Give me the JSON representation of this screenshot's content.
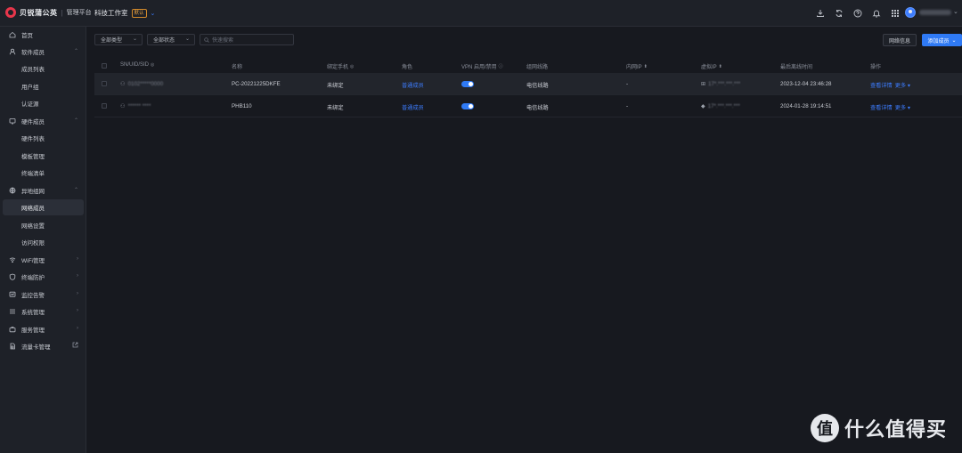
{
  "brand": {
    "name": "贝锐蒲公英",
    "sep": "|",
    "subtitle": "管理平台"
  },
  "workspace": {
    "name": "科技工作室",
    "badge": "默认"
  },
  "sidebar": {
    "items": [
      {
        "label": "首页"
      },
      {
        "label": "软件成员"
      },
      {
        "label": "成员列表"
      },
      {
        "label": "用户组"
      },
      {
        "label": "认证源"
      },
      {
        "label": "硬件成员"
      },
      {
        "label": "硬件列表"
      },
      {
        "label": "模板管理"
      },
      {
        "label": "终端清单"
      },
      {
        "label": "异地组网"
      },
      {
        "label": "网络成员"
      },
      {
        "label": "网络设置"
      },
      {
        "label": "访问权限"
      },
      {
        "label": "WiFi管理"
      },
      {
        "label": "终端防护"
      },
      {
        "label": "监控告警"
      },
      {
        "label": "系统管理"
      },
      {
        "label": "服务管理"
      },
      {
        "label": "流量卡管理"
      }
    ]
  },
  "toolbar": {
    "type_filter": "全部类型",
    "status_filter": "全部状态",
    "search_placeholder": "快速搜索",
    "info_button": "网络信息",
    "add_button": "添加成员"
  },
  "table": {
    "headers": [
      "SN/UID/SID",
      "名称",
      "绑定手机",
      "角色",
      "VPN 启用/禁用",
      "组网线路",
      "内网IP",
      "虚拟IP",
      "最后离线时间",
      "操作"
    ],
    "rows": [
      {
        "sn": "0102*****0000",
        "name": "PC-20221225DKFE",
        "phone": "未绑定",
        "role": "普通成员",
        "route": "电信线路",
        "lan_ip": "-",
        "virtual_ip": "17*.***.***.***",
        "last_offline": "2023-12-04 23:46:28",
        "action": "查看详情",
        "more": "更多"
      },
      {
        "sn": "****** ****",
        "name": "PHB110",
        "phone": "未绑定",
        "role": "普通成员",
        "route": "电信线路",
        "lan_ip": "-",
        "virtual_ip": "17*.***.***.***",
        "last_offline": "2024-01-28 19:14:51",
        "action": "查看详情",
        "more": "更多"
      }
    ]
  },
  "watermark": {
    "badge": "值",
    "text": "什么值得买"
  },
  "colors": {
    "accent": "#2f7af5",
    "bg": "#17191f",
    "panel": "#1e2128",
    "brand": "#e8364b"
  }
}
